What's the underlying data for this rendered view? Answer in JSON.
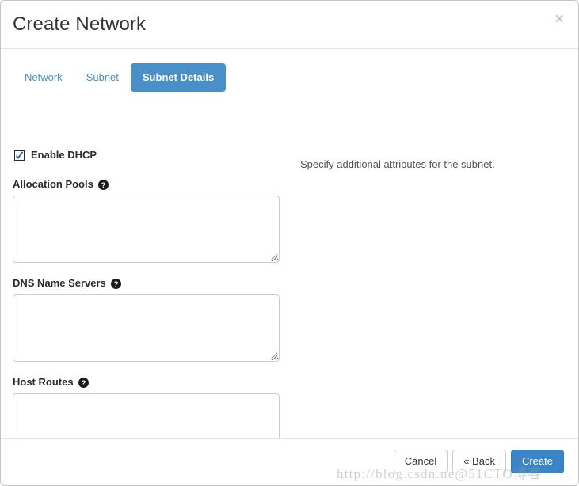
{
  "dialog": {
    "title": "Create Network",
    "close_icon": "close-icon",
    "close_label": "×"
  },
  "tabs": [
    {
      "id": "network",
      "label": "Network",
      "active": false
    },
    {
      "id": "subnet",
      "label": "Subnet",
      "active": false
    },
    {
      "id": "subnet-details",
      "label": "Subnet Details",
      "active": true
    }
  ],
  "form": {
    "enable_dhcp": {
      "label": "Enable DHCP",
      "checked": true,
      "icon": "checked-checkbox-icon"
    },
    "fields": [
      {
        "id": "allocation-pools",
        "label": "Allocation Pools",
        "help_icon": "question-mark-circle-icon",
        "value": "",
        "placeholder": ""
      },
      {
        "id": "dns-name-servers",
        "label": "DNS Name Servers",
        "help_icon": "question-mark-circle-icon",
        "value": "",
        "placeholder": ""
      },
      {
        "id": "host-routes",
        "label": "Host Routes",
        "help_icon": "question-mark-circle-icon",
        "value": "",
        "placeholder": ""
      }
    ]
  },
  "help_panel": {
    "text": "Specify additional attributes for the subnet."
  },
  "footer": {
    "buttons": [
      {
        "id": "cancel",
        "label": "Cancel",
        "style": "default"
      },
      {
        "id": "back",
        "label": "« Back",
        "style": "default"
      },
      {
        "id": "create",
        "label": "Create",
        "style": "primary"
      }
    ]
  },
  "watermark": {
    "text": "http://blog.csdn.ne@51CTO博客"
  },
  "colors": {
    "accent": "#4a90c8",
    "primary_button": "#3b85c6",
    "link": "#4a90c8",
    "border": "#cccccc",
    "text": "#333333"
  }
}
